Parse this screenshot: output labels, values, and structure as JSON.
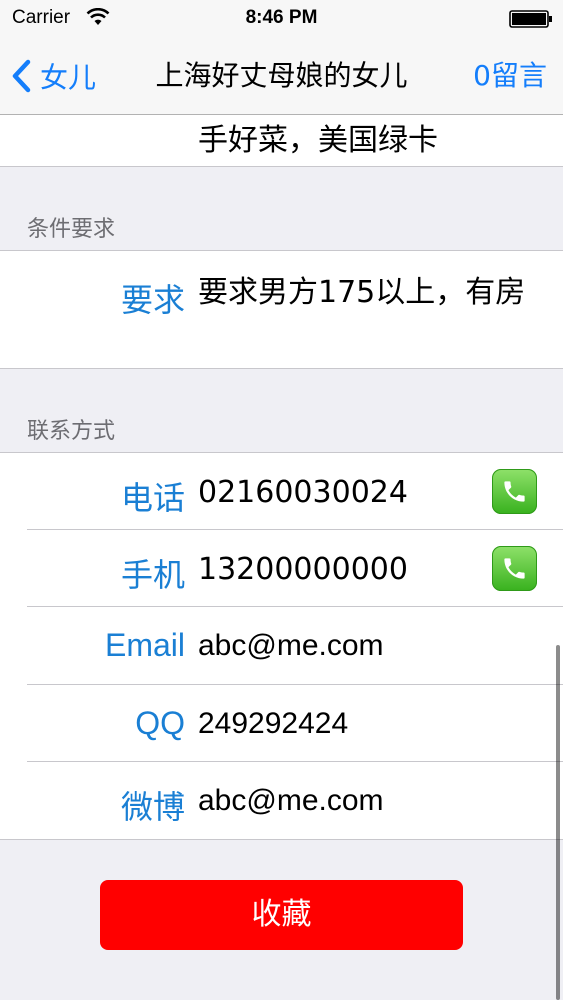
{
  "status_bar": {
    "carrier": "Carrier",
    "time": "8:46 PM"
  },
  "nav": {
    "back_label": "女儿",
    "title": "上海好丈母娘的女儿",
    "right_label": "0留言"
  },
  "intro": {
    "text_tail": "手好菜，美国绿卡"
  },
  "requirements": {
    "section_title": "条件要求",
    "label": "要求",
    "value": "要求男方175以上，有房"
  },
  "contact": {
    "section_title": "联系方式",
    "rows": [
      {
        "label": "电话",
        "value": "02160030024",
        "callable": true
      },
      {
        "label": "手机",
        "value": "13200000000",
        "callable": true
      },
      {
        "label": "Email",
        "value": "abc@me.com",
        "callable": false
      },
      {
        "label": "QQ",
        "value": "249292424",
        "callable": false
      },
      {
        "label": "微博",
        "value": "abc@me.com",
        "callable": false
      }
    ]
  },
  "favorite_button": {
    "label": "收藏"
  },
  "colors": {
    "accent": "#147efb",
    "label_blue": "#1a7fd4",
    "favorite_red": "#ff0000",
    "phone_green": "#4cd964"
  },
  "icons": {
    "back": "chevron-left-icon",
    "wifi": "wifi-icon",
    "battery": "battery-icon",
    "phone": "phone-icon"
  }
}
